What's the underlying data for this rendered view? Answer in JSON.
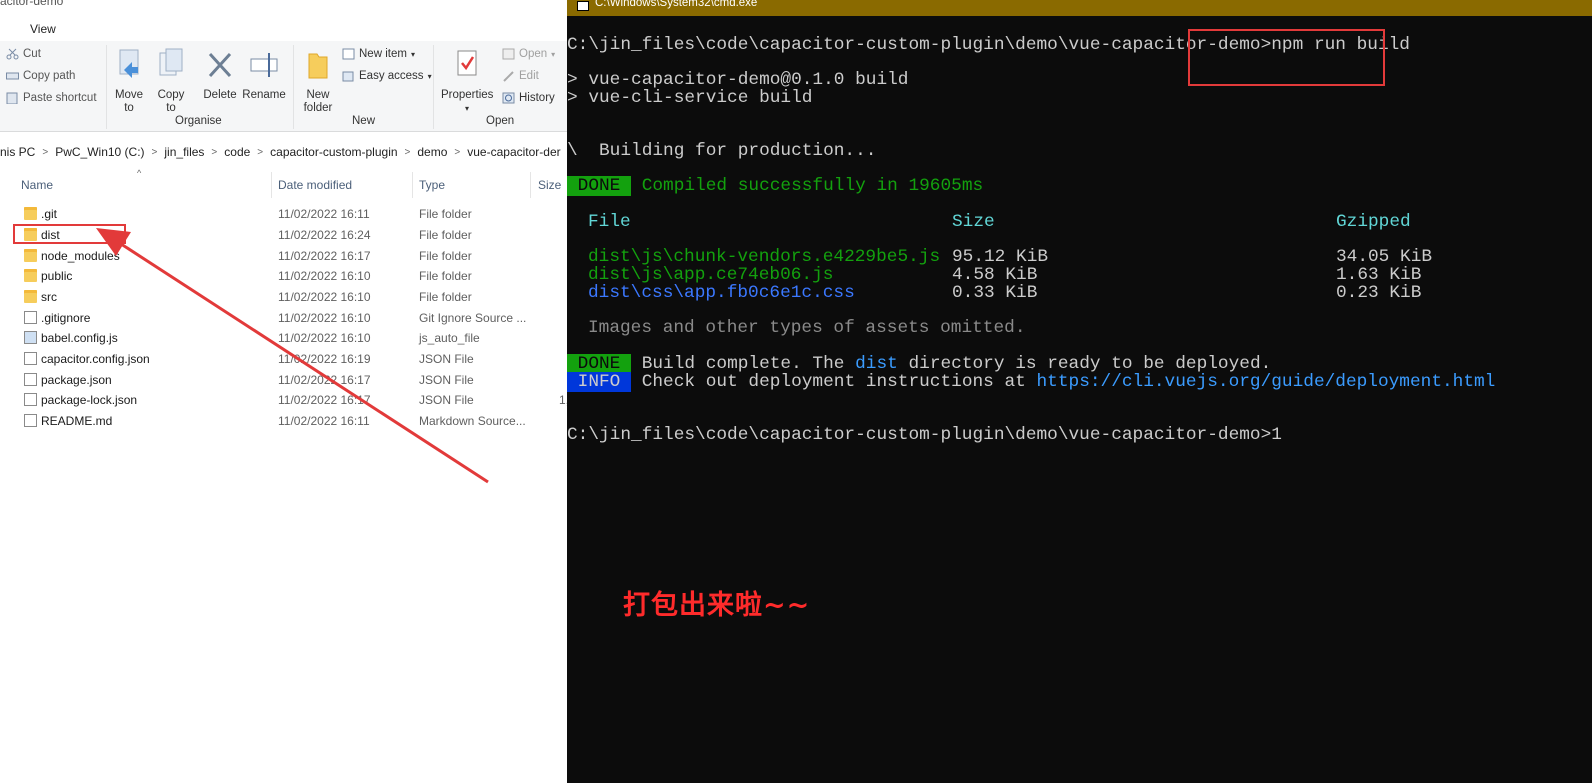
{
  "explorer": {
    "window_title": "acitor-demo",
    "tabs": [
      "View"
    ],
    "ribbon": {
      "clipboard": {
        "cut": "Cut",
        "copy_path": "Copy path",
        "paste_shortcut": "Paste shortcut"
      },
      "organise": {
        "move_to": "Move to",
        "copy_to": "Copy to",
        "delete": "Delete",
        "rename": "Rename",
        "group_label": "Organise"
      },
      "new": {
        "new_folder": "New folder",
        "new_item": "New item",
        "easy_access": "Easy access",
        "group_label": "New"
      },
      "open": {
        "properties": "Properties",
        "open": "Open",
        "edit": "Edit",
        "history": "History",
        "group_label": "Open"
      }
    },
    "address": [
      "nis PC",
      "PwC_Win10 (C:)",
      "jin_files",
      "code",
      "capacitor-custom-plugin",
      "demo",
      "vue-capacitor-der"
    ],
    "columns": {
      "name": "Name",
      "date": "Date modified",
      "type": "Type",
      "size": "Size"
    },
    "files": [
      {
        "name": ".git",
        "date": "11/02/2022 16:11",
        "type": "File folder",
        "size": "",
        "icon": "folder-icon"
      },
      {
        "name": "dist",
        "date": "11/02/2022 16:24",
        "type": "File folder",
        "size": "",
        "icon": "folder-icon"
      },
      {
        "name": "node_modules",
        "date": "11/02/2022 16:17",
        "type": "File folder",
        "size": "",
        "icon": "folder-icon"
      },
      {
        "name": "public",
        "date": "11/02/2022 16:10",
        "type": "File folder",
        "size": "",
        "icon": "folder-icon"
      },
      {
        "name": "src",
        "date": "11/02/2022 16:10",
        "type": "File folder",
        "size": "",
        "icon": "folder-icon"
      },
      {
        "name": ".gitignore",
        "date": "11/02/2022 16:10",
        "type": "Git Ignore Source ...",
        "size": "",
        "icon": "file-icon"
      },
      {
        "name": "babel.config.js",
        "date": "11/02/2022 16:10",
        "type": "js_auto_file",
        "size": "",
        "icon": "js-file-icon"
      },
      {
        "name": "capacitor.config.json",
        "date": "11/02/2022 16:19",
        "type": "JSON File",
        "size": "",
        "icon": "json-file-icon"
      },
      {
        "name": "package.json",
        "date": "11/02/2022 16:17",
        "type": "JSON File",
        "size": "",
        "icon": "json-file-icon"
      },
      {
        "name": "package-lock.json",
        "date": "11/02/2022 16:17",
        "type": "JSON File",
        "size": "1,",
        "icon": "json-file-icon"
      },
      {
        "name": "README.md",
        "date": "11/02/2022 16:11",
        "type": "Markdown Source...",
        "size": "",
        "icon": "md-file-icon"
      }
    ]
  },
  "cmd": {
    "title": "C:\\Windows\\System32\\cmd.exe",
    "prompt1": "C:\\jin_files\\code\\capacitor-custom-plugin\\demo\\vue-capacitor-demo>",
    "command": "npm run build",
    "out1": "> vue-capacitor-demo@0.1.0 build",
    "out2": "> vue-cli-service build",
    "building": "\\  Building for production...",
    "done_tag": " DONE ",
    "info_tag": " INFO ",
    "compiled": " Compiled successfully in 19605ms",
    "table_headers": {
      "file": "File",
      "size": "Size",
      "gzipped": "Gzipped"
    },
    "assets": [
      {
        "file": "dist\\js\\chunk-vendors.e4229be5.js",
        "size": "95.12 KiB",
        "gzipped": "34.05 KiB",
        "color": "#13a10e"
      },
      {
        "file": "dist\\js\\app.ce74eb06.js",
        "size": "4.58 KiB",
        "gzipped": "1.63 KiB",
        "color": "#13a10e"
      },
      {
        "file": "dist\\css\\app.fb0c6e1c.css",
        "size": "0.33 KiB",
        "gzipped": "0.23 KiB",
        "color": "#3b78ff"
      }
    ],
    "omitted": "Images and other types of assets omitted.",
    "build_complete_a": " Build complete. The ",
    "build_complete_dist": "dist",
    "build_complete_b": " directory is ready to be deployed.",
    "checkout": " Check out deployment instructions at ",
    "url": "https://cli.vuejs.org/guide/deployment.html",
    "prompt2": "C:\\jin_files\\code\\capacitor-custom-plugin\\demo\\vue-capacitor-demo>1"
  },
  "annotation": {
    "text": "打包出来啦~~",
    "color": "#ff2b2b"
  }
}
